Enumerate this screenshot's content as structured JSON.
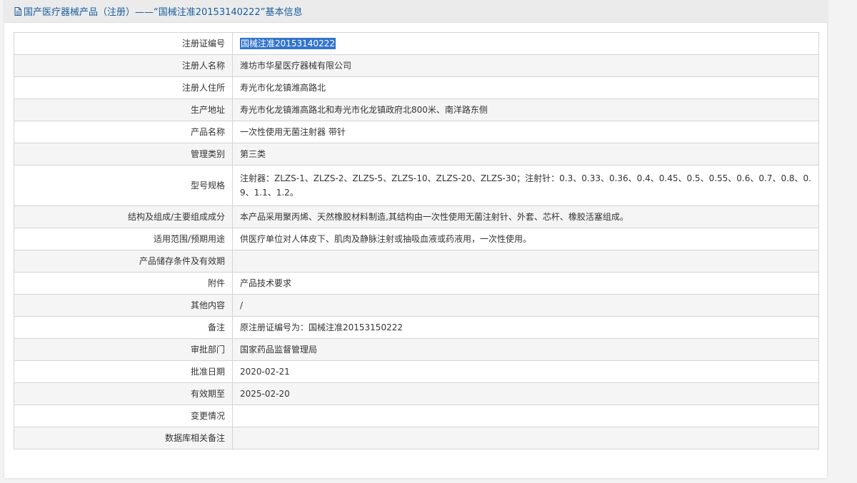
{
  "page": {
    "title": "国产医疗器械产品（注册）——“国械注准20153140222”基本信息"
  },
  "rows": [
    {
      "label": "注册证编号",
      "value": "国械注准20153140222",
      "highlight": true
    },
    {
      "label": "注册人名称",
      "value": "潍坊市华星医疗器械有限公司"
    },
    {
      "label": "注册人住所",
      "value": "寿光市化龙镇潍高路北"
    },
    {
      "label": "生产地址",
      "value": "寿光市化龙镇潍高路北和寿光市化龙镇政府北800米、南洋路东侧"
    },
    {
      "label": "产品名称",
      "value": "一次性使用无菌注射器 带针"
    },
    {
      "label": "管理类别",
      "value": "第三类"
    },
    {
      "label": "型号规格",
      "value": "注射器：ZLZS-1、ZLZS-2、ZLZS-5、ZLZS-10、ZLZS-20、ZLZS-30；注射针：0.3、0.33、0.36、0.4、0.45、0.5、0.55、0.6、0.7、0.8、0.9、1.1、1.2。",
      "tall": true
    },
    {
      "label": "结构及组成/主要组成成分",
      "value": "本产品采用聚丙烯、天然橡胶材料制造,其结构由一次性使用无菌注射针、外套、芯杆、橡胶活塞组成。"
    },
    {
      "label": "适用范围/预期用途",
      "value": "供医疗单位对人体皮下、肌肉及静脉注射或抽吸血液或药液用，一次性使用。"
    },
    {
      "label": "产品储存条件及有效期",
      "value": ""
    },
    {
      "label": "附件",
      "value": "产品技术要求"
    },
    {
      "label": "其他内容",
      "value": "/"
    },
    {
      "label": "备注",
      "value": "原注册证编号为：国械注准20153150222"
    },
    {
      "label": "审批部门",
      "value": "国家药品监督管理局"
    },
    {
      "label": "批准日期",
      "value": "2020-02-21"
    },
    {
      "label": "有效期至",
      "value": "2025-02-20"
    },
    {
      "label": "变更情况",
      "value": ""
    },
    {
      "label": "数据库相关备注",
      "value": ""
    }
  ],
  "colors": {
    "title_text": "#1a5d9c",
    "title_bg": "#ebebeb",
    "selection_bg": "#3374cc"
  },
  "icons": {
    "title": "document-icon"
  }
}
